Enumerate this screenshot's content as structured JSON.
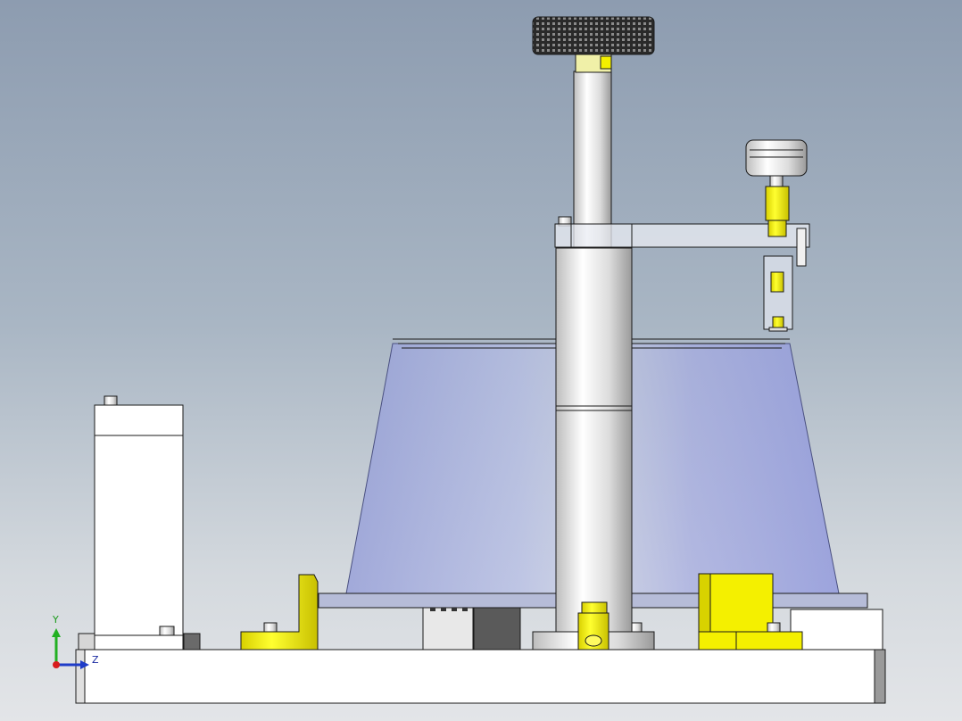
{
  "viewport": {
    "background_top": "#8d9cb0",
    "background_bottom": "#e3e5e8"
  },
  "triad": {
    "y_label": "Y",
    "z_label": "Z",
    "y_color": "#22b022",
    "z_color": "#1f3cc8",
    "x_color": "#d81c1c"
  },
  "colors": {
    "highlight_yellow": "#f4f000",
    "transparent_shell": "#9aa4e0",
    "edge": "#1a1a1a"
  }
}
